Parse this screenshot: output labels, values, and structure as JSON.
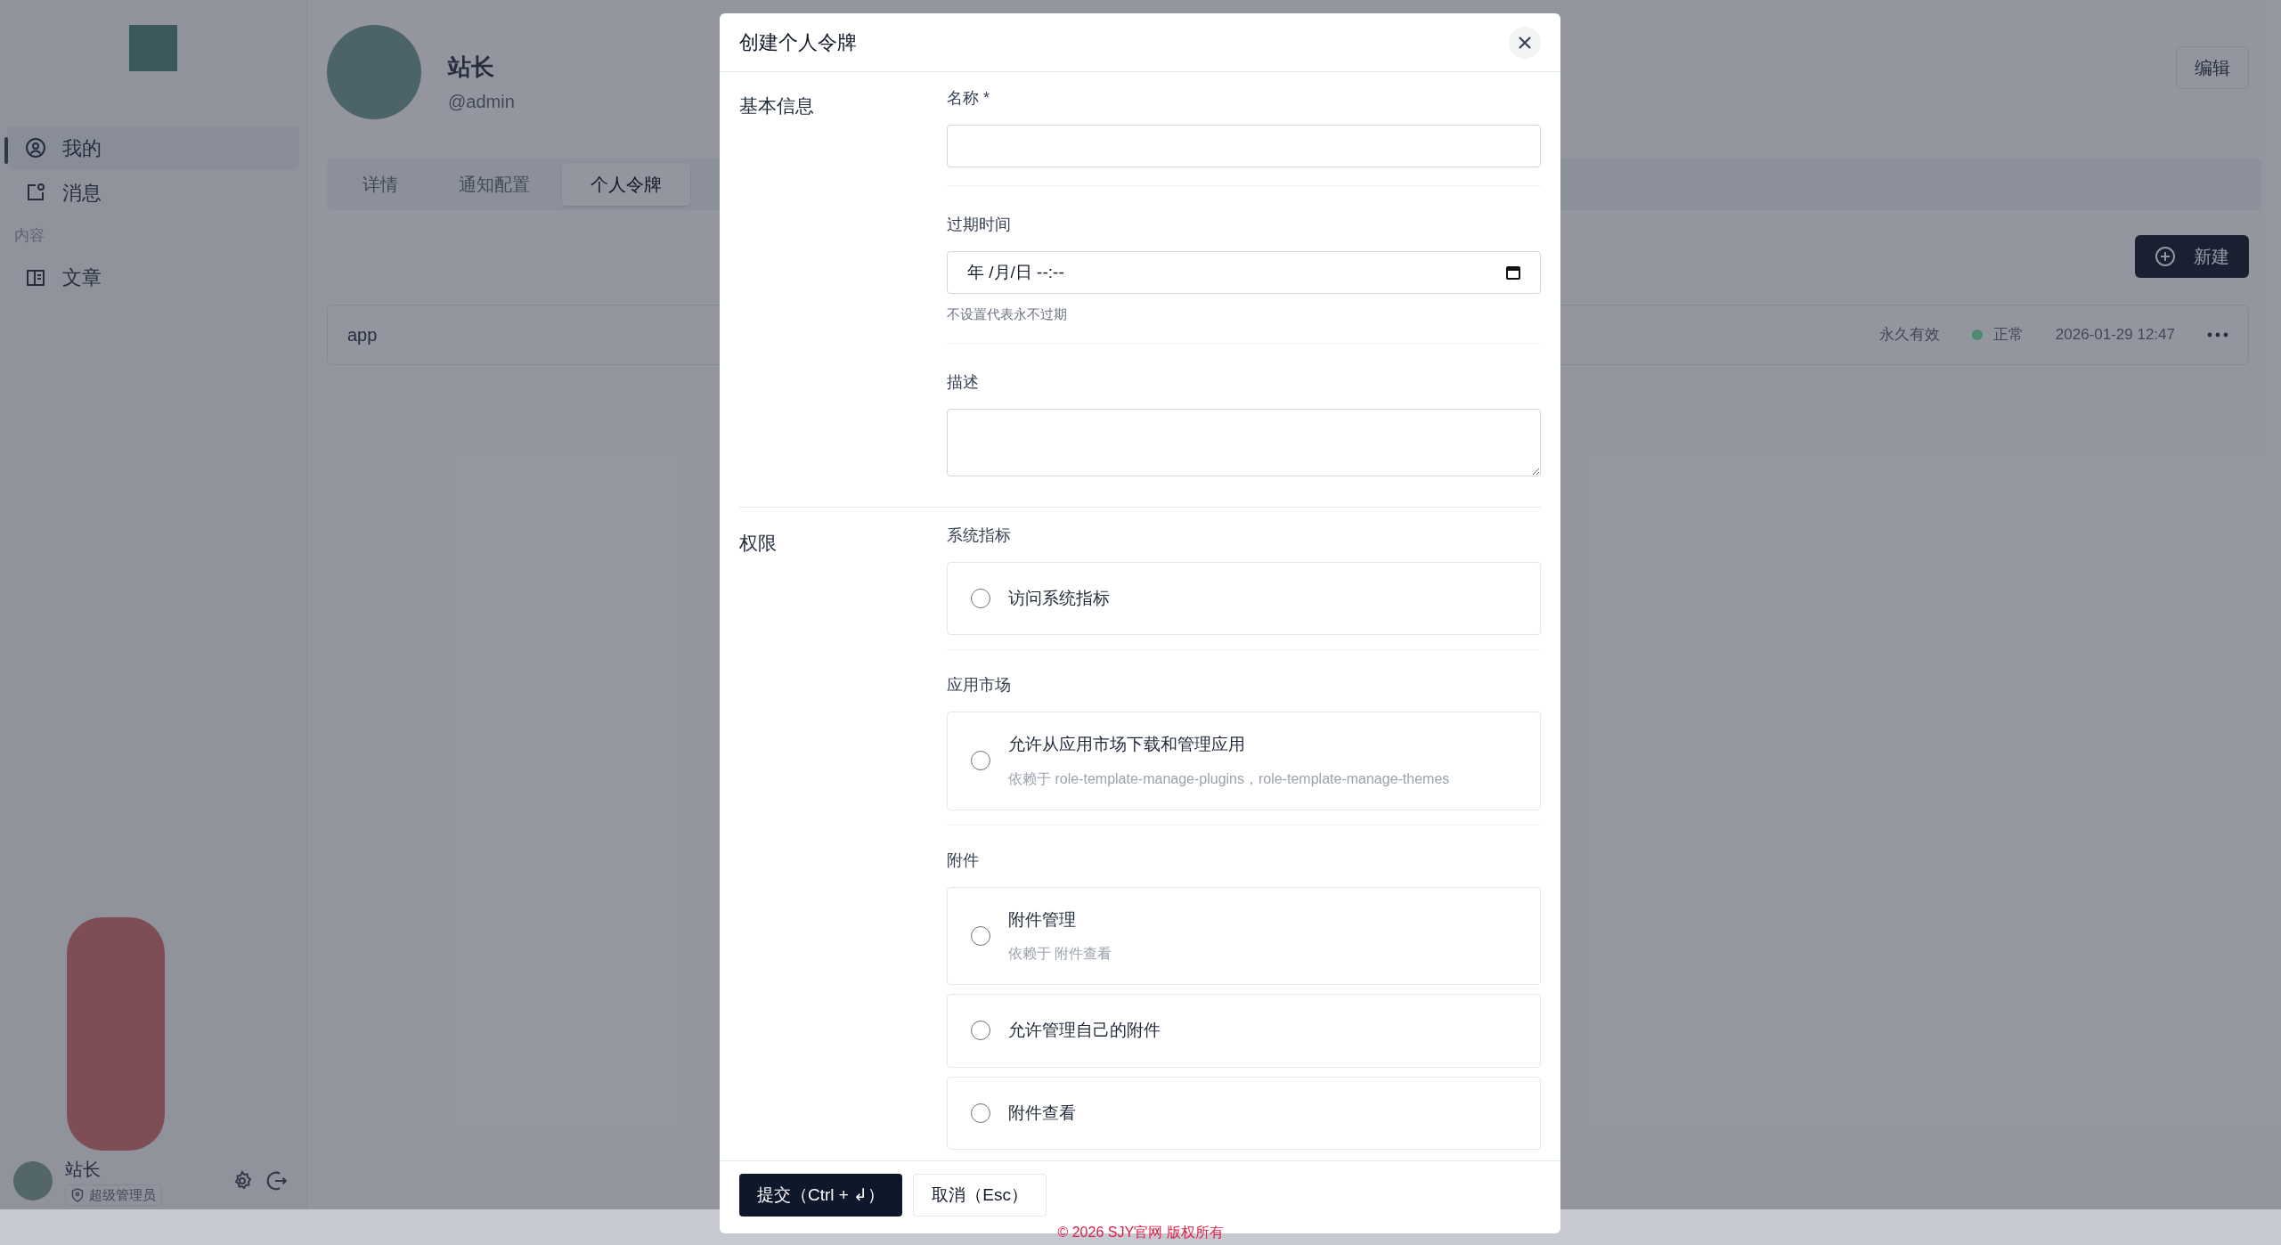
{
  "sidebar": {
    "nav": [
      {
        "kind": "user",
        "label": "我的",
        "selected": true
      },
      {
        "kind": "message",
        "label": "消息",
        "selected": false
      }
    ],
    "section_label": "内容",
    "content_nav": [
      {
        "kind": "book",
        "label": "文章",
        "selected": false
      }
    ],
    "user": {
      "name": "站长",
      "role": "超级管理员"
    }
  },
  "profile": {
    "name": "站长",
    "handle": "@admin",
    "edit_button": "编辑"
  },
  "tabs": [
    {
      "label": "详情",
      "selected": false
    },
    {
      "label": "通知配置",
      "selected": false
    },
    {
      "label": "个人令牌",
      "selected": true
    }
  ],
  "new_button": "新建",
  "tokens": [
    {
      "name": "app",
      "expiry": "永久有效",
      "status": "正常",
      "color": "#4f8a70",
      "created": "2026-01-29 12:47"
    }
  ],
  "modal": {
    "title": "创建个人令牌",
    "sections": [
      {
        "title": "基本信息",
        "fields": [
          {
            "kind": "text",
            "label": "名称 *"
          },
          {
            "kind": "datetime",
            "label": "过期时间",
            "value": "年 /月/日 --:--",
            "help": "不设置代表永不过期"
          },
          {
            "kind": "textarea",
            "label": "描述"
          }
        ]
      },
      {
        "title": "权限",
        "groups": [
          {
            "title": "系统指标",
            "items": [
              {
                "label": "访问系统指标",
                "checked": false
              }
            ]
          },
          {
            "title": "应用市场",
            "items": [
              {
                "label": "允许从应用市场下载和管理应用",
                "dependency": "依赖于 role-template-manage-plugins，role-template-manage-themes",
                "checked": false
              }
            ]
          },
          {
            "title": "附件",
            "items": [
              {
                "label": "附件管理",
                "dependency": "依赖于 附件查看",
                "checked": false
              },
              {
                "label": "允许管理自己的附件",
                "checked": false
              },
              {
                "label": "附件查看",
                "checked": false
              }
            ]
          }
        ]
      }
    ],
    "submit": "提交（Ctrl + ↲）",
    "cancel": "取消（Esc）"
  },
  "footer": "© 2026 SJY官网 版权所有"
}
